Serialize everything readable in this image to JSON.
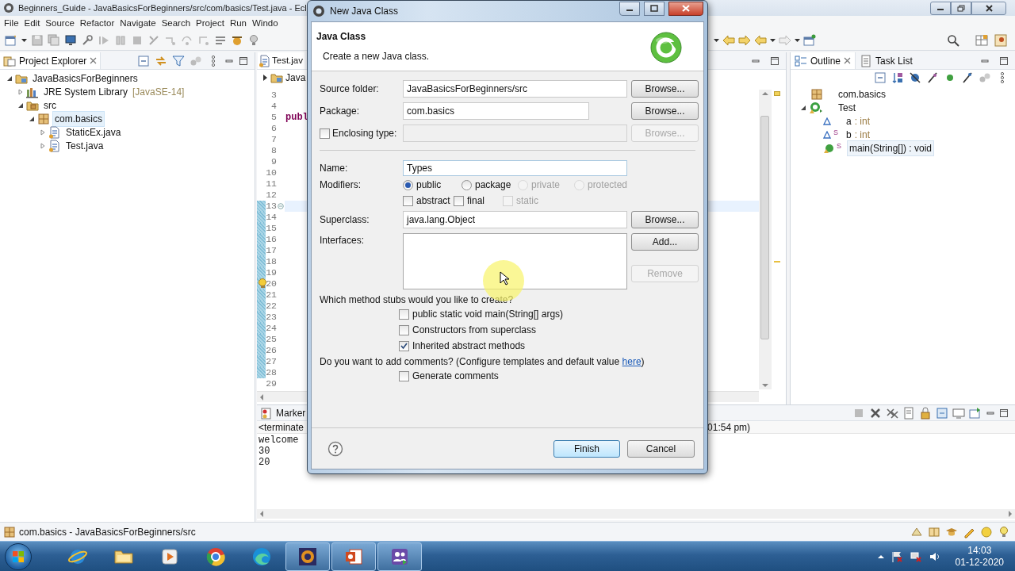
{
  "window": {
    "title": "Beginners_Guide - JavaBasicsForBeginners/src/com/basics/Test.java - Ecl"
  },
  "menu": [
    "File",
    "Edit",
    "Source",
    "Refactor",
    "Navigate",
    "Search",
    "Project",
    "Run",
    "Windo"
  ],
  "project_explorer": {
    "title": "Project Explorer",
    "tree": [
      {
        "label": "JavaBasicsForBeginners",
        "kind": "project",
        "expanded": true,
        "selected": false,
        "children": [
          {
            "label": "JRE System Library",
            "note": "[JavaSE-14]",
            "kind": "library",
            "expanded": false,
            "selected": false
          },
          {
            "label": "src",
            "kind": "source-folder",
            "expanded": true,
            "selected": false,
            "children": [
              {
                "label": "com.basics",
                "kind": "package",
                "expanded": true,
                "selected": true,
                "children": [
                  {
                    "label": "StaticEx.java",
                    "kind": "java-file",
                    "expanded": false,
                    "selected": false
                  },
                  {
                    "label": "Test.java",
                    "kind": "java-file",
                    "expanded": false,
                    "selected": false
                  }
                ]
              }
            ]
          }
        ]
      }
    ]
  },
  "editor": {
    "tab": "Test.jav",
    "breadcrumb": "Java",
    "lines": [
      {
        "number": "3",
        "changed": false,
        "warning": false,
        "fold": false,
        "current": false
      },
      {
        "number": "4",
        "changed": false,
        "warning": false,
        "fold": false,
        "current": false
      },
      {
        "number": "5",
        "text": "publ",
        "changed": false,
        "warning": false,
        "fold": false,
        "current": false
      },
      {
        "number": "6",
        "changed": false,
        "warning": false,
        "fold": false,
        "current": false
      },
      {
        "number": "7",
        "changed": false,
        "warning": false,
        "fold": false,
        "current": false
      },
      {
        "number": "8",
        "changed": false,
        "warning": false,
        "fold": false,
        "current": false
      },
      {
        "number": "9",
        "changed": false,
        "warning": false,
        "fold": false,
        "current": false
      },
      {
        "number": "10",
        "changed": false,
        "warning": false,
        "fold": false,
        "current": false
      },
      {
        "number": "11",
        "changed": false,
        "warning": false,
        "fold": false,
        "current": false
      },
      {
        "number": "12",
        "changed": false,
        "warning": false,
        "fold": false,
        "current": false
      },
      {
        "number": "13",
        "changed": true,
        "warning": false,
        "fold": true,
        "current": true
      },
      {
        "number": "14",
        "changed": true,
        "warning": false,
        "fold": false,
        "current": false
      },
      {
        "number": "15",
        "changed": true,
        "warning": false,
        "fold": false,
        "current": false
      },
      {
        "number": "16",
        "changed": true,
        "warning": false,
        "fold": false,
        "current": false
      },
      {
        "number": "17",
        "changed": true,
        "warning": false,
        "fold": false,
        "current": false
      },
      {
        "number": "18",
        "changed": true,
        "warning": false,
        "fold": false,
        "current": false
      },
      {
        "number": "19",
        "changed": true,
        "warning": false,
        "fold": false,
        "current": false
      },
      {
        "number": "20",
        "changed": true,
        "warning": true,
        "fold": false,
        "current": false
      },
      {
        "number": "21",
        "changed": true,
        "warning": false,
        "fold": false,
        "current": false
      },
      {
        "number": "22",
        "changed": true,
        "warning": false,
        "fold": false,
        "current": false
      },
      {
        "number": "23",
        "changed": true,
        "warning": false,
        "fold": false,
        "current": false
      },
      {
        "number": "24",
        "changed": true,
        "warning": false,
        "fold": false,
        "current": false
      },
      {
        "number": "25",
        "changed": true,
        "warning": false,
        "fold": false,
        "current": false
      },
      {
        "number": "26",
        "changed": true,
        "warning": false,
        "fold": false,
        "current": false
      },
      {
        "number": "27",
        "changed": true,
        "warning": false,
        "fold": false,
        "current": false
      },
      {
        "number": "28",
        "changed": true,
        "warning": false,
        "fold": false,
        "current": false
      },
      {
        "number": "29",
        "changed": false,
        "warning": false,
        "fold": false,
        "current": false
      }
    ]
  },
  "outline": {
    "tabs": [
      {
        "label": "Outline",
        "selected": true
      },
      {
        "label": "Task List",
        "selected": false
      }
    ],
    "tree": [
      {
        "label": "com.basics",
        "kind": "package",
        "selected": false
      },
      {
        "label": "Test",
        "kind": "class",
        "expanded": true,
        "selected": false,
        "children": [
          {
            "label": "a",
            "type": ": int",
            "kind": "field",
            "selected": false
          },
          {
            "label": "b",
            "type": ": int",
            "kind": "field",
            "modifier": "S",
            "selected": false
          },
          {
            "label": "main(String[]) : void",
            "kind": "method",
            "modifier": "S",
            "selected": true
          }
        ]
      }
    ]
  },
  "console": {
    "tab": "Marker",
    "header": "<terminate",
    "header_end": "01:54 pm)",
    "output": [
      "welcome",
      "30",
      "20"
    ]
  },
  "dialog": {
    "title": "New Java Class",
    "heading": "Java Class",
    "description": "Create a new Java class.",
    "source_folder": {
      "label": "Source folder:",
      "value": "JavaBasicsForBeginners/src",
      "button": "Browse..."
    },
    "package": {
      "label": "Package:",
      "value": "com.basics",
      "button": "Browse..."
    },
    "enclosing_type": {
      "label": "Enclosing type:",
      "checked": false,
      "disabled": true,
      "button": "Browse..."
    },
    "name": {
      "label": "Name:",
      "value": "Types"
    },
    "modifiers": {
      "label": "Modifiers:",
      "access": [
        {
          "label": "public",
          "selected": true,
          "disabled": false
        },
        {
          "label": "package",
          "selected": false,
          "disabled": false
        },
        {
          "label": "private",
          "selected": false,
          "disabled": true
        },
        {
          "label": "protected",
          "selected": false,
          "disabled": true
        }
      ],
      "options": [
        {
          "label": "abstract",
          "checked": false,
          "disabled": false
        },
        {
          "label": "final",
          "checked": false,
          "disabled": false
        },
        {
          "label": "static",
          "checked": false,
          "disabled": true
        }
      ]
    },
    "superclass": {
      "label": "Superclass:",
      "value": "java.lang.Object",
      "button": "Browse..."
    },
    "interfaces": {
      "label": "Interfaces:",
      "buttons": [
        {
          "label": "Add...",
          "disabled": false
        },
        {
          "label": "Remove",
          "disabled": true
        }
      ]
    },
    "stubs": {
      "question": "Which method stubs would you like to create?",
      "options": [
        {
          "label": "public static void main(String[] args)",
          "checked": false
        },
        {
          "label": "Constructors from superclass",
          "checked": false
        },
        {
          "label": "Inherited abstract methods",
          "checked": true
        }
      ]
    },
    "comments": {
      "question": "Do you want to add comments? (Configure templates and default value ",
      "link": "here",
      "question_end": ")",
      "option": {
        "label": "Generate comments",
        "checked": false
      }
    },
    "buttons": [
      {
        "label": "Finish",
        "default": true
      },
      {
        "label": "Cancel",
        "default": false
      }
    ]
  },
  "status_bar": {
    "text": "com.basics - JavaBasicsForBeginners/src"
  },
  "taskbar": {
    "apps": [
      {
        "kind": "browser-e",
        "active": false
      },
      {
        "kind": "folder",
        "active": false
      },
      {
        "kind": "media",
        "active": false
      },
      {
        "kind": "browser-ring",
        "active": false
      },
      {
        "kind": "browser-wave",
        "active": false
      },
      {
        "kind": "ide",
        "active": true
      },
      {
        "kind": "slides",
        "active": true
      },
      {
        "kind": "meeting",
        "active": true
      }
    ],
    "time": "14:03",
    "date": "01-12-2020"
  }
}
